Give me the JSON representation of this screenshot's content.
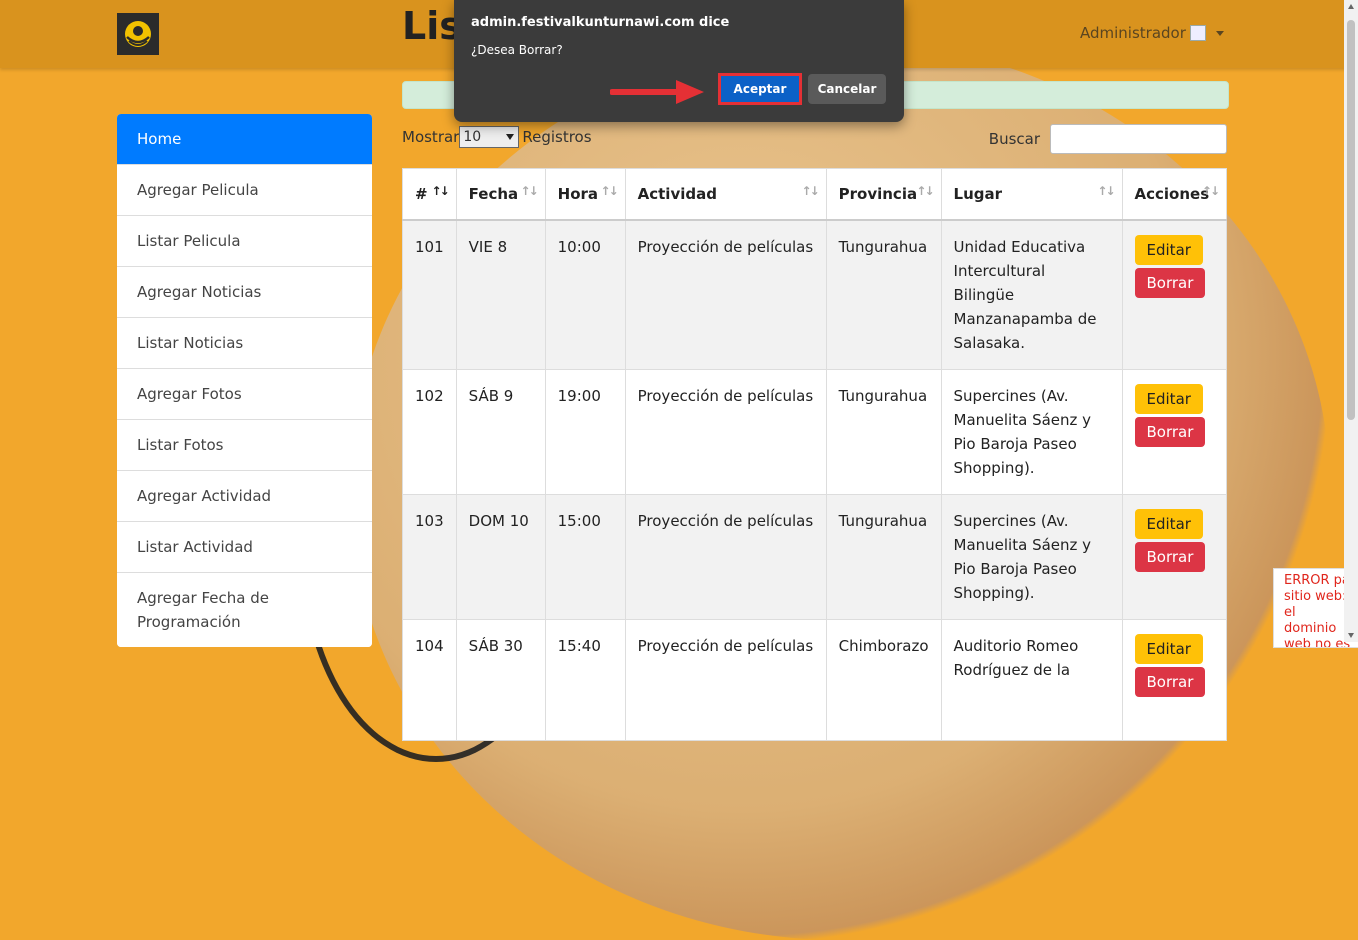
{
  "header": {
    "page_title": "List",
    "user_label": "Administrador"
  },
  "sidebar": {
    "items": [
      {
        "label": "Home"
      },
      {
        "label": "Agregar Pelicula"
      },
      {
        "label": "Listar Pelicula"
      },
      {
        "label": "Agregar Noticias"
      },
      {
        "label": "Listar Noticias"
      },
      {
        "label": "Agregar Fotos"
      },
      {
        "label": "Listar Fotos"
      },
      {
        "label": "Agregar Actividad"
      },
      {
        "label": "Listar Actividad"
      },
      {
        "label": "Agregar Fecha de Programación"
      }
    ]
  },
  "controls": {
    "show_label": "Mostrar",
    "show_value": "10",
    "records_label": "Registros",
    "search_label": "Buscar",
    "search_value": ""
  },
  "table": {
    "headers": [
      "#",
      "Fecha",
      "Hora",
      "Actividad",
      "Provincia",
      "Lugar",
      "Acciones"
    ],
    "rows": [
      {
        "id": "101",
        "fecha": "VIE 8",
        "hora": "10:00",
        "actividad": "Proyección de películas",
        "provincia": "Tungurahua",
        "lugar": "Unidad Educativa Intercultural Bilingüe Manzanapamba de Salasaka."
      },
      {
        "id": "102",
        "fecha": "SÁB 9",
        "hora": "19:00",
        "actividad": "Proyección de películas",
        "provincia": "Tungurahua",
        "lugar": "Supercines (Av. Manuelita Sáenz y Pio Baroja Paseo Shopping)."
      },
      {
        "id": "103",
        "fecha": "DOM 10",
        "hora": "15:00",
        "actividad": "Proyección de películas",
        "provincia": "Tungurahua",
        "lugar": "Supercines (Av. Manuelita Sáenz y Pio Baroja Paseo Shopping)."
      },
      {
        "id": "104",
        "fecha": "SÁB 30",
        "hora": "15:40",
        "actividad": "Proyección de películas",
        "provincia": "Chimborazo",
        "lugar": "Auditorio Romeo Rodríguez de la"
      }
    ],
    "edit_label": "Editar",
    "delete_label": "Borrar"
  },
  "dialog": {
    "origin": "admin.festivalkunturnawi.com dice",
    "message": "¿Desea Borrar?",
    "accept_label": "Aceptar",
    "cancel_label": "Cancelar"
  },
  "error_box": {
    "text": "ERROR pa sitio web: el dominio web no es"
  }
}
